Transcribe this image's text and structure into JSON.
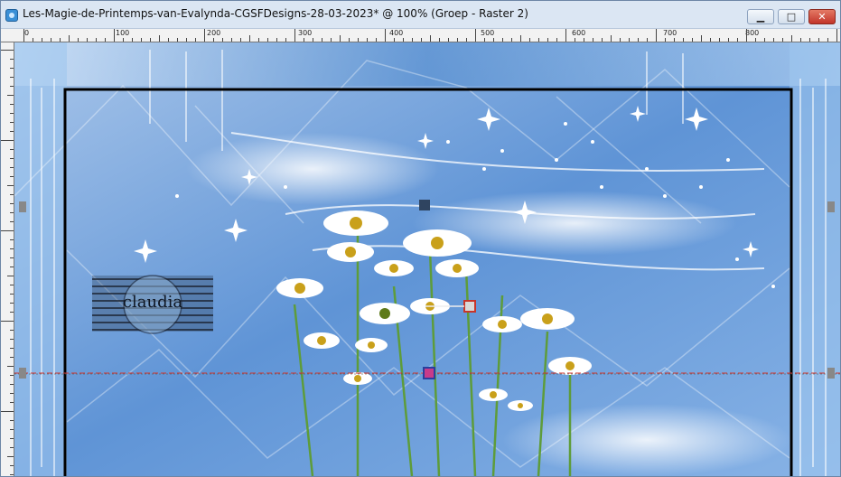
{
  "window": {
    "title": "Les-Magie-de-Printemps-van-Evalynda-CGSFDesigns-28-03-2023* @ 100% (Groep - Raster 2)",
    "minimize_glyph": "▁",
    "maximize_glyph": "□",
    "close_glyph": "✕"
  },
  "ruler": {
    "labels": [
      "0",
      "100",
      "200",
      "300",
      "400",
      "500",
      "600",
      "700",
      "800"
    ]
  },
  "canvas": {
    "watermark_text": "claudia"
  },
  "colors": {
    "sky": "#6d9fd8",
    "accent_guide": "#d0342c",
    "titlebar": "#dbe6f3"
  }
}
